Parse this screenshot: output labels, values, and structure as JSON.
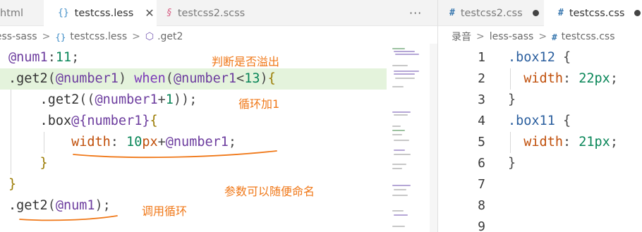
{
  "left_tabs": [
    {
      "label": "html",
      "icon": "none",
      "active": false
    },
    {
      "label": "testcss.less",
      "icon": "less-braces-icon",
      "active": true,
      "close": "✕"
    },
    {
      "label": "testcss2.scss",
      "icon": "scss-icon",
      "active": false
    }
  ],
  "more_actions": "···",
  "right_tabs": [
    {
      "label": "testcss2.css",
      "icon": "css-hash-icon",
      "modified": true
    },
    {
      "label": "testcss.css",
      "icon": "css-hash-icon",
      "modified": true
    }
  ],
  "left_breadcrumb": {
    "folder": "less-sass",
    "file": "testcss.less",
    "symbol": ".get2"
  },
  "right_breadcrumb": {
    "folder1": "录音",
    "folder2": "less-sass",
    "file": "testcss.css"
  },
  "icons": {
    "braces": "{}",
    "hash": "#",
    "scss": "§",
    "chevron": ">",
    "cube": "⬡"
  },
  "left_code": [
    [
      {
        "t": "@num1",
        "c": "var"
      },
      {
        "t": ":",
        "c": "punct"
      },
      {
        "t": "11",
        "c": "num"
      },
      {
        "t": ";",
        "c": "punct"
      }
    ],
    [
      {
        "t": ".get2",
        "c": "plain"
      },
      {
        "t": "(",
        "c": "punct"
      },
      {
        "t": "@number1",
        "c": "var"
      },
      {
        "t": ") ",
        "c": "punct"
      },
      {
        "t": "when",
        "c": "kw"
      },
      {
        "t": "(",
        "c": "punct"
      },
      {
        "t": "@number1",
        "c": "var"
      },
      {
        "t": "<",
        "c": "punct"
      },
      {
        "t": "13",
        "c": "num"
      },
      {
        "t": ")",
        "c": "punct"
      },
      {
        "t": "{",
        "c": "brace"
      }
    ],
    [
      {
        "t": "    .get2",
        "c": "plain"
      },
      {
        "t": "((",
        "c": "punct"
      },
      {
        "t": "@number1",
        "c": "var"
      },
      {
        "t": "+",
        "c": "punct"
      },
      {
        "t": "1",
        "c": "num"
      },
      {
        "t": "));",
        "c": "punct"
      }
    ],
    [
      {
        "t": "    .box",
        "c": "plain"
      },
      {
        "t": "@{number1}",
        "c": "var"
      },
      {
        "t": "{",
        "c": "brace"
      }
    ],
    [
      {
        "t": "        width",
        "c": "prop"
      },
      {
        "t": ": ",
        "c": "punct"
      },
      {
        "t": "10",
        "c": "num"
      },
      {
        "t": "px",
        "c": "prop"
      },
      {
        "t": "+",
        "c": "punct"
      },
      {
        "t": "@number1",
        "c": "var"
      },
      {
        "t": ";",
        "c": "punct"
      }
    ],
    [
      {
        "t": "    }",
        "c": "brace"
      }
    ],
    [
      {
        "t": "}",
        "c": "brace"
      }
    ],
    [
      {
        "t": ".get2",
        "c": "plain"
      },
      {
        "t": "(",
        "c": "punct"
      },
      {
        "t": "@num1",
        "c": "var"
      },
      {
        "t": ");",
        "c": "punct"
      }
    ]
  ],
  "annotations": {
    "overflow": "判断是否溢出",
    "loop_add": "循环加1",
    "param_name": "参数可以随便命名",
    "call_loop": "调用循环"
  },
  "right_code": [
    [
      {
        "t": ".box12",
        "c": "sel"
      },
      {
        "t": " {",
        "c": "punct"
      }
    ],
    [
      {
        "t": "  width",
        "c": "prop"
      },
      {
        "t": ": ",
        "c": "punct"
      },
      {
        "t": "22px",
        "c": "num"
      },
      {
        "t": ";",
        "c": "punct"
      }
    ],
    [
      {
        "t": "}",
        "c": "punct"
      }
    ],
    [
      {
        "t": ".box11",
        "c": "sel"
      },
      {
        "t": " {",
        "c": "punct"
      }
    ],
    [
      {
        "t": "  width",
        "c": "prop"
      },
      {
        "t": ": ",
        "c": "punct"
      },
      {
        "t": "21px",
        "c": "num"
      },
      {
        "t": ";",
        "c": "punct"
      }
    ],
    [
      {
        "t": "}",
        "c": "punct"
      }
    ],
    [],
    [],
    []
  ],
  "right_line_numbers": [
    "1",
    "2",
    "3",
    "4",
    "5",
    "6",
    "7",
    "8",
    "9"
  ],
  "colors": {
    "annotation": "#f07818",
    "highlight": "#e4f3dc"
  }
}
